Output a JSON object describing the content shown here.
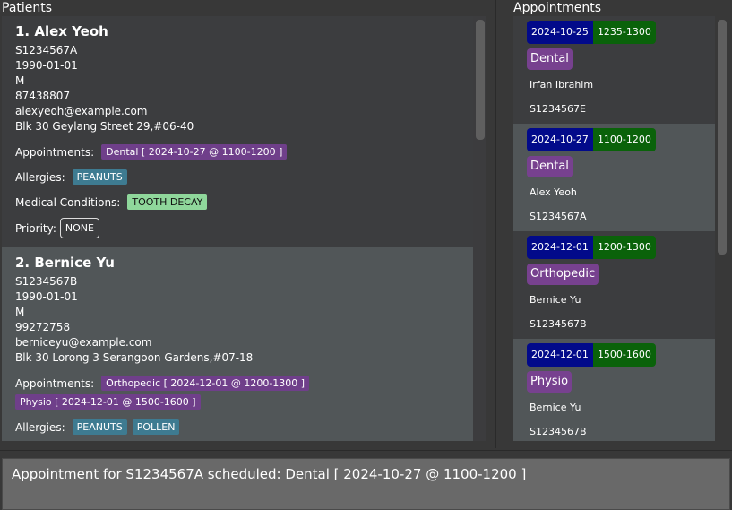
{
  "patients_panel": {
    "title": "Patients",
    "labels": {
      "appointments": "Appointments:",
      "allergies": "Allergies:",
      "medical_conditions": "Medical Conditions:",
      "priority": "Priority:"
    },
    "patients": [
      {
        "index_name": "1.  Alex Yeoh",
        "nric": "S1234567A",
        "dob": "1990-01-01",
        "sex": "M",
        "phone": "87438807",
        "email": "alexyeoh@example.com",
        "address": "Blk 30 Geylang Street 29,#06-40",
        "appointments": [
          "Dental [ 2024-10-27 @ 1100-1200 ]"
        ],
        "allergies": [
          "PEANUTS"
        ],
        "medical_conditions": [
          "TOOTH DECAY"
        ],
        "priority": "NONE"
      },
      {
        "index_name": "2.  Bernice Yu",
        "nric": "S1234567B",
        "dob": "1990-01-01",
        "sex": "M",
        "phone": "99272758",
        "email": "berniceyu@example.com",
        "address": "Blk 30 Lorong 3 Serangoon Gardens,#07-18",
        "appointments": [
          "Orthopedic [ 2024-12-01 @ 1200-1300 ]",
          "Physio [ 2024-12-01 @ 1500-1600 ]"
        ],
        "allergies": [
          "PEANUTS",
          "POLLEN"
        ]
      }
    ]
  },
  "appointments_panel": {
    "title": "Appointments",
    "appointments": [
      {
        "date": "2024-10-25",
        "time": "1235-1300",
        "type": "Dental",
        "name": "Irfan Ibrahim",
        "nric": "S1234567E"
      },
      {
        "date": "2024-10-27",
        "time": "1100-1200",
        "type": "Dental",
        "name": "Alex Yeoh",
        "nric": "S1234567A"
      },
      {
        "date": "2024-12-01",
        "time": "1200-1300",
        "type": "Orthopedic",
        "name": "Bernice Yu",
        "nric": "S1234567B"
      },
      {
        "date": "2024-12-01",
        "time": "1500-1600",
        "type": "Physio",
        "name": "Bernice Yu",
        "nric": "S1234567B"
      }
    ]
  },
  "result_display": {
    "text": "Appointment for S1234567A scheduled: Dental [ 2024-10-27 @ 1100-1200 ]"
  },
  "colors": {
    "appointment_tag": "#6f3f8a",
    "allergy_tag": "#3e7b91",
    "condition_tag": "#8fd79b",
    "date_badge": "#020a8a",
    "time_badge": "#0a620a"
  }
}
